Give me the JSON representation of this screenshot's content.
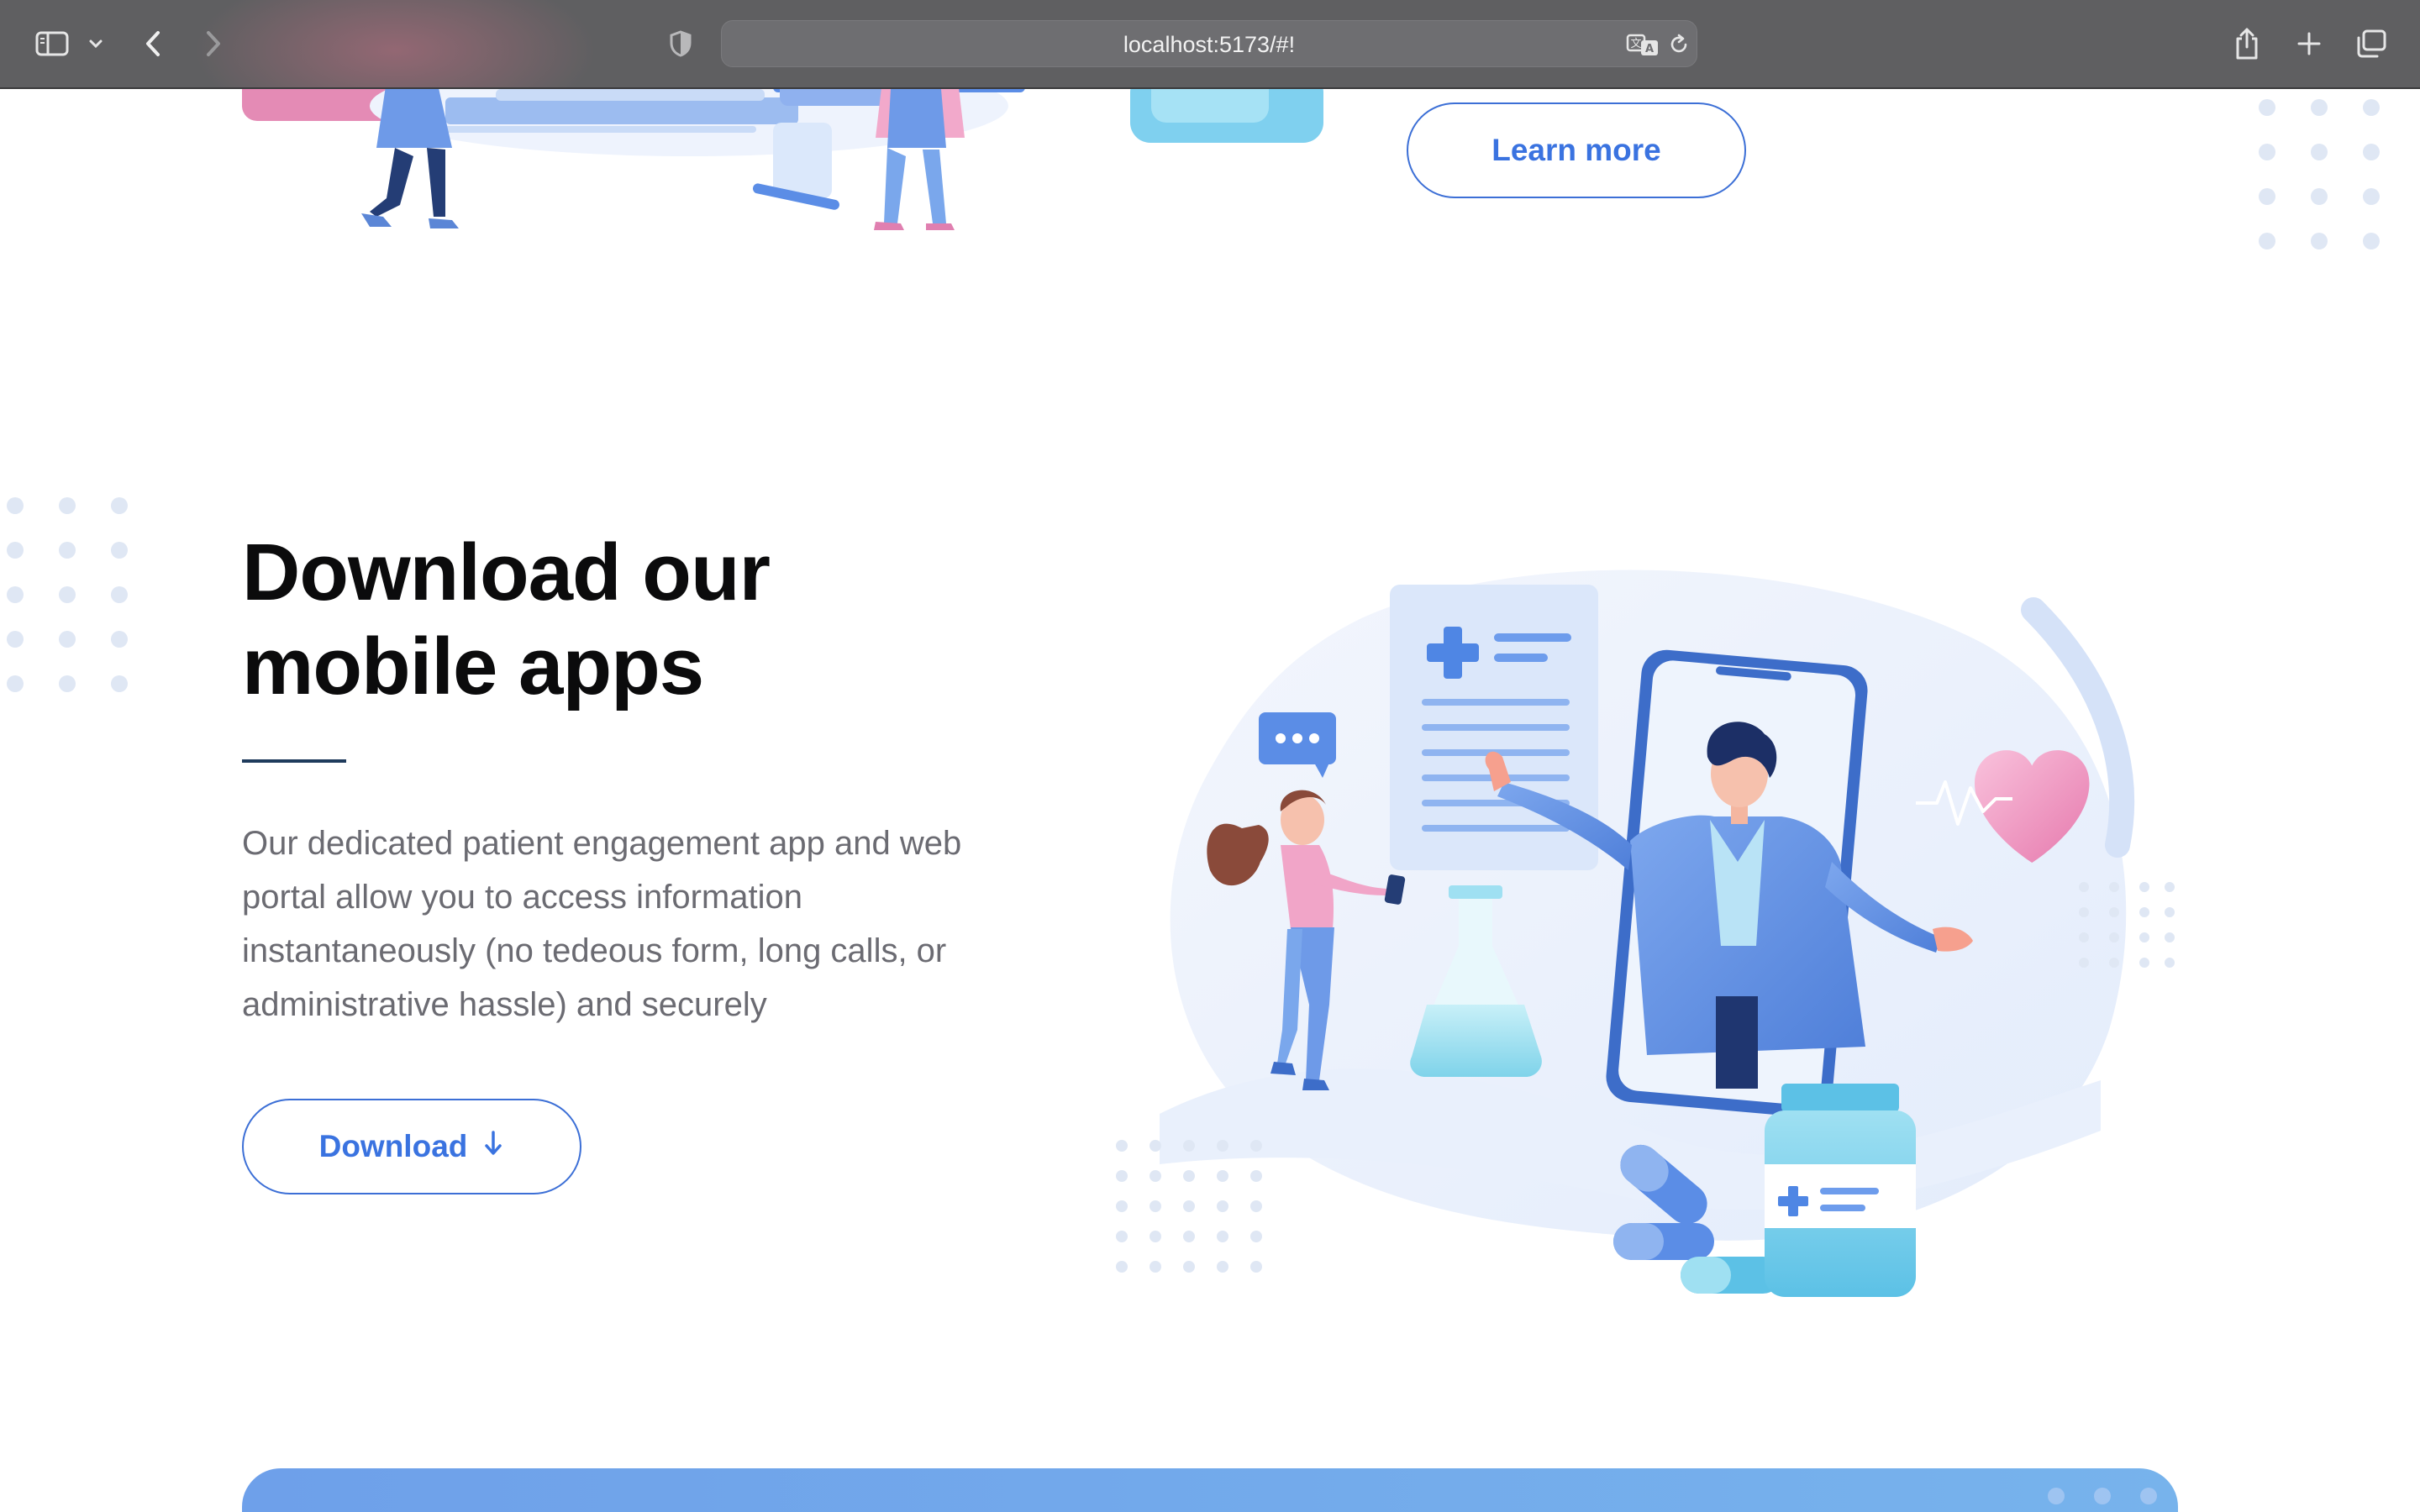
{
  "browser": {
    "url": "localhost:5173/#!",
    "icons": [
      "sidebar-icon",
      "chevron-down-icon",
      "back-icon",
      "forward-icon",
      "privacy-shield-icon",
      "translate-icon",
      "reload-icon",
      "share-icon",
      "new-tab-icon",
      "tab-overview-icon"
    ]
  },
  "top_section": {
    "learn_more_label": "Learn more"
  },
  "apps_section": {
    "heading": "Download our mobile apps",
    "description": "Our dedicated patient engagement app and web portal allow you to access information instantaneously (no tedeous form, long calls, or administrative hassle) and securely",
    "download_label": "Download",
    "download_icon": "arrow-down-icon"
  },
  "colors": {
    "accent": "#3a73e0",
    "heading": "#0b0b0c",
    "body_text": "#6b6b72",
    "cta_band_start": "#6ea0ea",
    "cta_band_end": "#77b3ec"
  }
}
